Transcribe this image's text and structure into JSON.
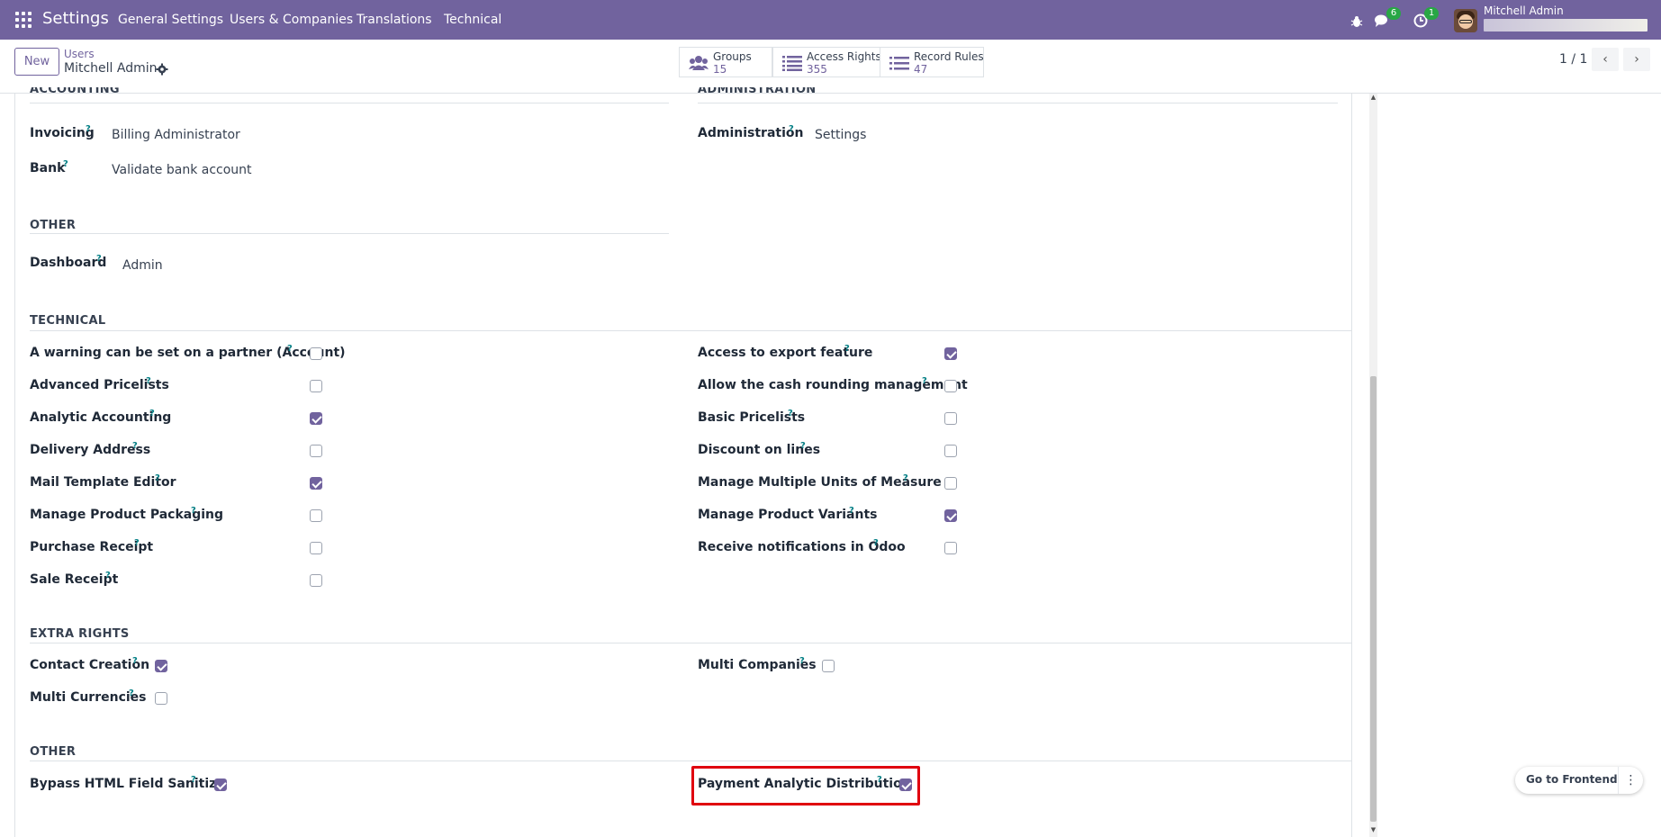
{
  "navbar": {
    "brand": "Settings",
    "menu": [
      "General Settings",
      "Users & Companies",
      "Translations",
      "Technical"
    ],
    "messages_count": "6",
    "activities_count": "1",
    "user_name": "Mitchell Admin"
  },
  "control": {
    "new_label": "New",
    "breadcrumb": "Users",
    "record_title": "Mitchell Admin",
    "stats": [
      {
        "label": "Groups",
        "value": "15"
      },
      {
        "label": "Access Rights",
        "value": "355"
      },
      {
        "label": "Record Rules",
        "value": "47"
      }
    ],
    "pager": "1 / 1"
  },
  "sections": {
    "accounting": {
      "title": "ACCOUNTING",
      "fields": [
        {
          "label": "Invoicing",
          "value": "Billing Administrator"
        },
        {
          "label": "Bank",
          "value": "Validate bank account"
        }
      ]
    },
    "administration": {
      "title": "ADMINISTRATION",
      "fields": [
        {
          "label": "Administration",
          "value": "Settings"
        }
      ]
    },
    "other1": {
      "title": "OTHER",
      "fields": [
        {
          "label": "Dashboard",
          "value": "Admin"
        }
      ]
    },
    "technical": {
      "title": "TECHNICAL",
      "left": [
        {
          "label": "A warning can be set on a partner (Account)",
          "checked": false
        },
        {
          "label": "Advanced Pricelists",
          "checked": false
        },
        {
          "label": "Analytic Accounting",
          "checked": true
        },
        {
          "label": "Delivery Address",
          "checked": false
        },
        {
          "label": "Mail Template Editor",
          "checked": true
        },
        {
          "label": "Manage Product Packaging",
          "checked": false
        },
        {
          "label": "Purchase Receipt",
          "checked": false
        },
        {
          "label": "Sale Receipt",
          "checked": false
        }
      ],
      "right": [
        {
          "label": "Access to export feature",
          "checked": true
        },
        {
          "label": "Allow the cash rounding management",
          "checked": false
        },
        {
          "label": "Basic Pricelists",
          "checked": false
        },
        {
          "label": "Discount on lines",
          "checked": false
        },
        {
          "label": "Manage Multiple Units of Measure",
          "checked": false
        },
        {
          "label": "Manage Product Variants",
          "checked": true
        },
        {
          "label": "Receive notifications in Odoo",
          "checked": false
        }
      ]
    },
    "extra_rights": {
      "title": "EXTRA RIGHTS",
      "left": [
        {
          "label": "Contact Creation",
          "checked": true
        },
        {
          "label": "Multi Currencies",
          "checked": false
        }
      ],
      "right": [
        {
          "label": "Multi Companies",
          "checked": false
        }
      ]
    },
    "other2": {
      "title": "OTHER",
      "left": [
        {
          "label": "Bypass HTML Field Sanitize",
          "checked": true
        }
      ],
      "right": [
        {
          "label": "Payment Analytic Distribution",
          "checked": true
        }
      ]
    }
  },
  "help_mark": "?",
  "frontend_button": "Go to Frontend",
  "colors": {
    "brand": "#71639e",
    "highlight": "#e0000f",
    "badge": "#28a745"
  }
}
